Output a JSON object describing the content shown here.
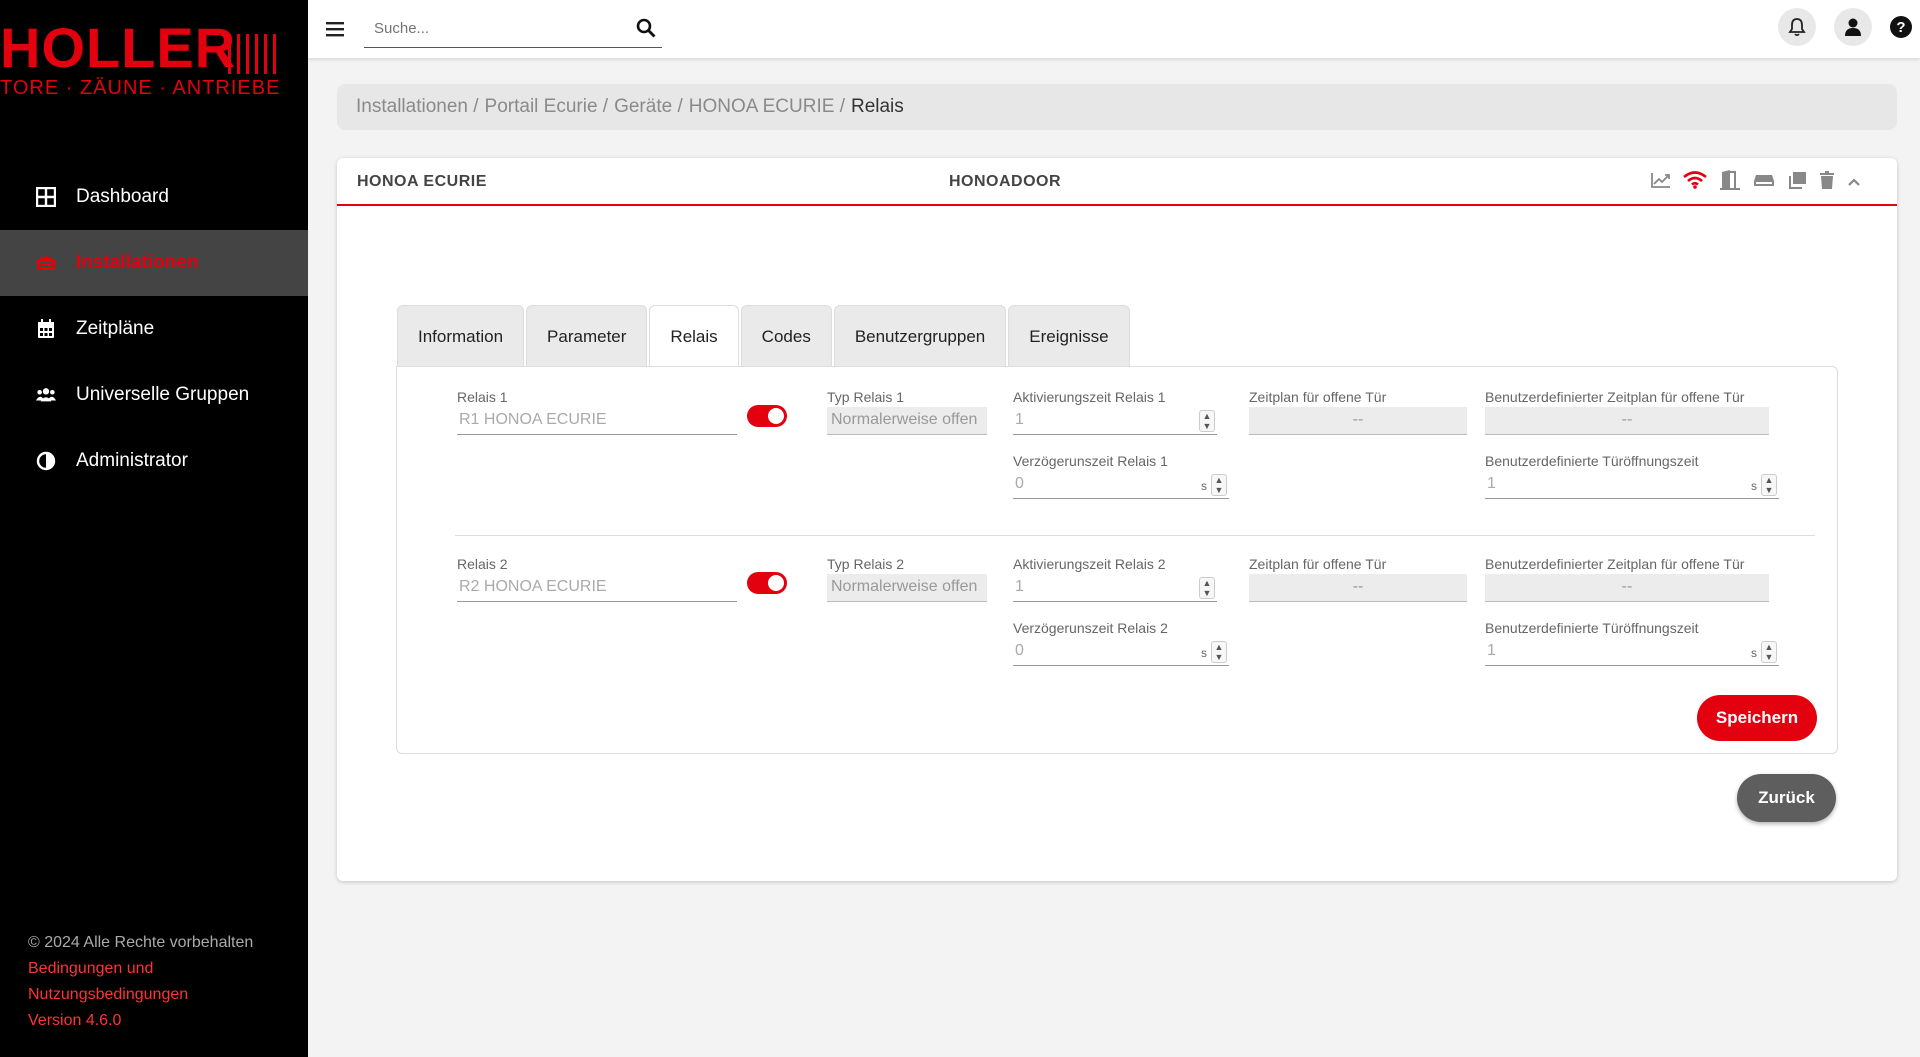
{
  "brand": {
    "logo_text": "HOLLER",
    "tagline": "TORE · ZÄUNE · ANTRIEBE",
    "accent_color": "#e3000f"
  },
  "sidebar": {
    "items": [
      {
        "label": "Dashboard",
        "icon": "grid-icon",
        "active": false
      },
      {
        "label": "Installationen",
        "icon": "garage-icon",
        "active": true
      },
      {
        "label": "Zeitpläne",
        "icon": "calendar-icon",
        "active": false
      },
      {
        "label": "Universelle Gruppen",
        "icon": "users-icon",
        "active": false
      },
      {
        "label": "Administrator",
        "icon": "contrast-icon",
        "active": false
      }
    ],
    "footer": {
      "copyright": "© 2024 Alle Rechte vorbehalten",
      "terms_link": "Bedingungen und Nutzungsbedingungen",
      "version": "Version 4.6.0"
    }
  },
  "topbar": {
    "search_placeholder": "Suche..."
  },
  "breadcrumb": {
    "items": [
      "Installationen /",
      "Portail Ecurie /",
      "Geräte /",
      "HONOA ECURIE /"
    ],
    "current": "Relais"
  },
  "card": {
    "title": "HONOA ECURIE",
    "subtitle": "HONOADOOR",
    "icons": [
      "chart-icon",
      "wifi-icon",
      "door-icon",
      "storage-icon",
      "copy-icon",
      "trash-icon",
      "chevron-up-icon"
    ]
  },
  "tabs": [
    {
      "label": "Information",
      "active": false
    },
    {
      "label": "Parameter",
      "active": false
    },
    {
      "label": "Relais",
      "active": true
    },
    {
      "label": "Codes",
      "active": false
    },
    {
      "label": "Benutzergruppen",
      "active": false
    },
    {
      "label": "Ereignisse",
      "active": false
    }
  ],
  "relays": [
    {
      "name_label": "Relais 1",
      "name_value": "R1 HONOA ECURIE",
      "enabled": true,
      "type_label": "Typ Relais 1",
      "type_value": "Normalerweise offen",
      "activation_label": "Aktivierungszeit Relais 1",
      "activation_value": "1",
      "schedule_label": "Zeitplan für offene Tür",
      "schedule_value": "--",
      "custom_schedule_label": "Benutzerdefinierter Zeitplan für offene Tür",
      "custom_schedule_value": "--",
      "delay_label": "Verzögerunszeit Relais 1",
      "delay_value": "0",
      "custom_open_label": "Benutzerdefinierte Türöffnungszeit",
      "custom_open_value": "1",
      "unit": "s"
    },
    {
      "name_label": "Relais 2",
      "name_value": "R2 HONOA ECURIE",
      "enabled": true,
      "type_label": "Typ Relais 2",
      "type_value": "Normalerweise offen",
      "activation_label": "Aktivierungszeit Relais 2",
      "activation_value": "1",
      "schedule_label": "Zeitplan für offene Tür",
      "schedule_value": "--",
      "custom_schedule_label": "Benutzerdefinierter Zeitplan für offene Tür",
      "custom_schedule_value": "--",
      "delay_label": "Verzögerunszeit Relais 2",
      "delay_value": "0",
      "custom_open_label": "Benutzerdefinierte Türöffnungszeit",
      "custom_open_value": "1",
      "unit": "s"
    }
  ],
  "buttons": {
    "save": "Speichern",
    "back": "Zurück"
  }
}
